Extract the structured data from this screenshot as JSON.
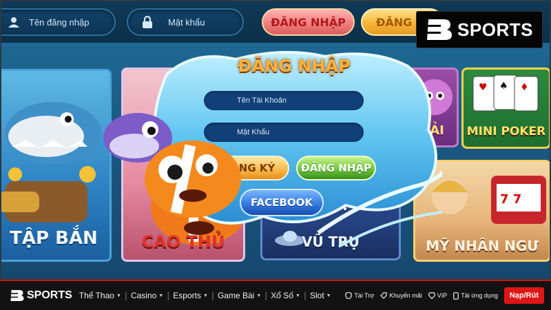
{
  "header": {
    "username_placeholder": "Tên đăng nhập",
    "password_placeholder": "Mật khẩu",
    "login_button": "ĐĂNG NHẬP",
    "register_button_partial": "ĐĂNG"
  },
  "brand": {
    "logo_letter": "B",
    "name": "SPORTS"
  },
  "games": [
    {
      "label": "TẬP BẮN"
    },
    {
      "label": "CAO THỦ"
    },
    {
      "label": "VŨ TRỤ"
    },
    {
      "label": "HẢI"
    },
    {
      "label": "MINI POKER"
    },
    {
      "label": "MỸ NHÂN NGƯ"
    }
  ],
  "login_modal": {
    "title": "ĐĂNG NHẬP",
    "account_placeholder": "Tên Tài Khoản",
    "password_placeholder": "Mật Khẩu",
    "register_button": "ĐĂNG KÝ",
    "login_button": "ĐĂNG NHẬP",
    "facebook_button": "FACEBOOK"
  },
  "bottom_nav": {
    "logo_name": "SPORTS",
    "items": [
      "Thể Thao",
      "Casino",
      "Esports",
      "Game Bài",
      "Xổ Số",
      "Slot"
    ],
    "right_links": [
      "Tài Trợ",
      "Khuyến mãi",
      "VIP",
      "Tải ứng dụng"
    ],
    "deposit_button": "Nạp/Rút"
  },
  "colors": {
    "accent_red": "#e01616",
    "title_orange": "#ffb13b",
    "facebook_blue": "#2f76dd",
    "login_green": "#68c03a",
    "register_yellow": "#f7b849"
  }
}
